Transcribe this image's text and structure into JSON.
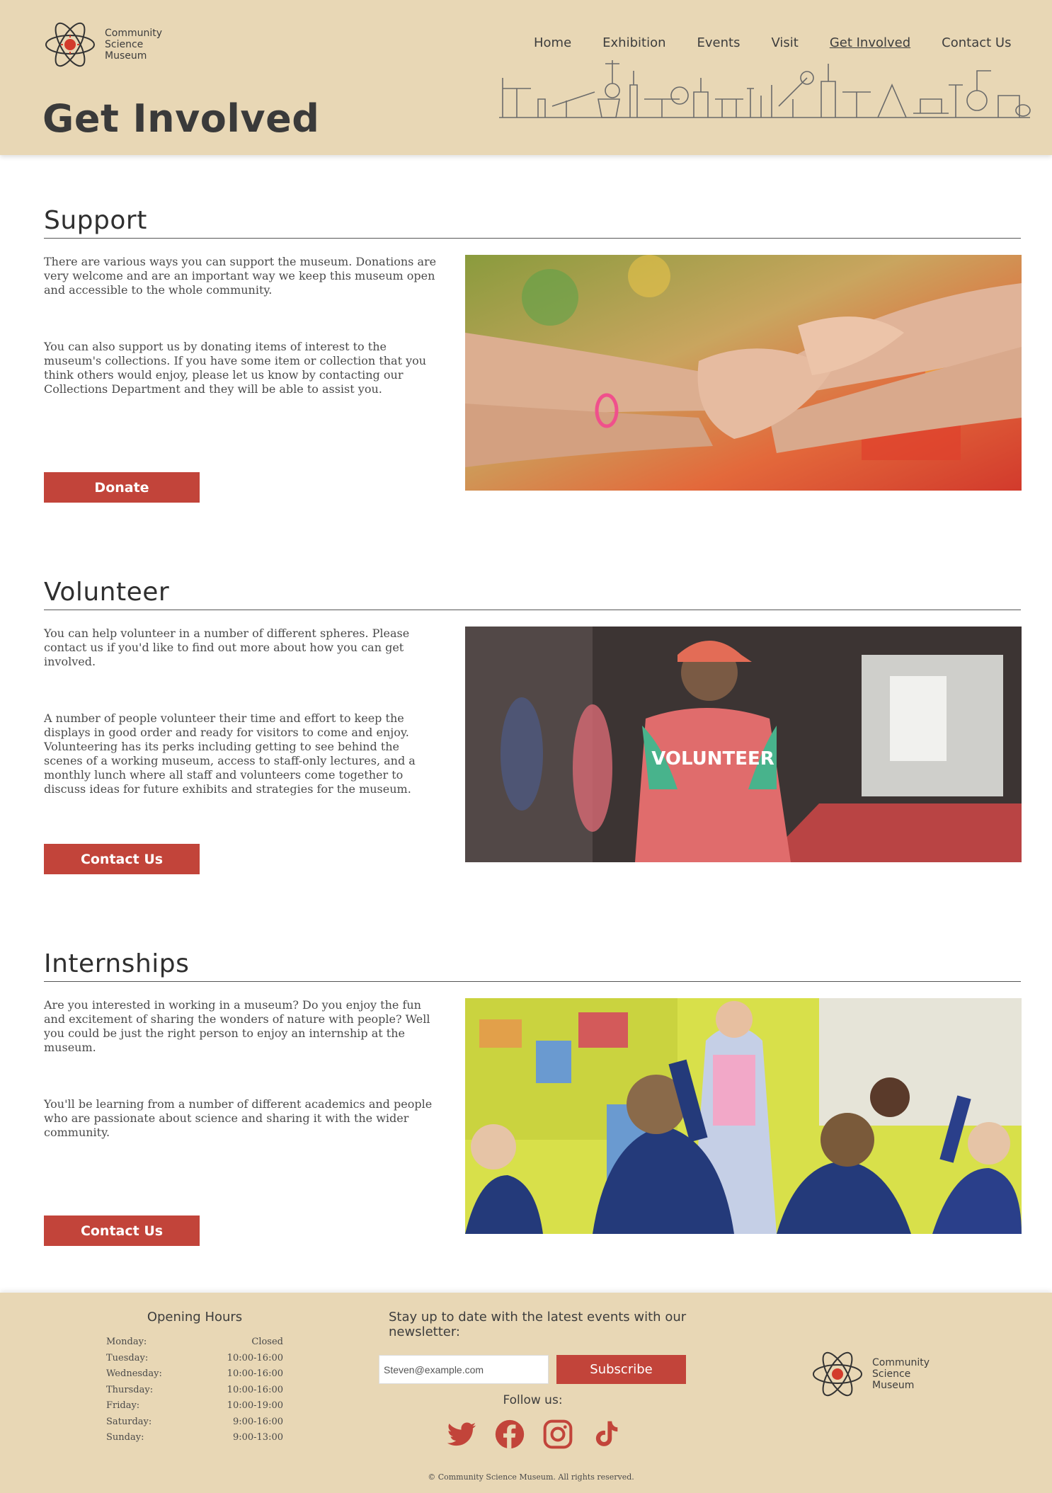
{
  "brand": {
    "line1": "Community",
    "line2": "Science",
    "line3": "Museum"
  },
  "nav": {
    "items": [
      {
        "label": "Home"
      },
      {
        "label": "Exhibition"
      },
      {
        "label": "Events"
      },
      {
        "label": "Visit"
      },
      {
        "label": "Get Involved"
      },
      {
        "label": "Contact Us"
      }
    ],
    "active": "Get Involved"
  },
  "page_title": "Get Involved",
  "sections": [
    {
      "heading": "Support",
      "paragraphs": [
        "There are various ways you can support the museum. Donations are very welcome and are an important way we keep this museum open and accessible to the whole community.",
        "You can also support us by donating items of interest to the museum's collections. If you have some item or collection that you think others would enjoy, please let us know by contacting our Collections Department and they will be able to assist you."
      ],
      "button": "Donate"
    },
    {
      "heading": "Volunteer",
      "paragraphs": [
        "You can help volunteer in a number of different spheres. Please contact us if you'd like to find out more about how you can get involved.",
        "A number of people volunteer their time and effort to keep the displays in good order and ready for visitors to come and enjoy. Volunteering has its perks including getting to see behind the scenes of a working museum, access to staff-only lectures, and a monthly lunch where all staff and volunteers come together to discuss ideas for future exhibits and strategies for the museum."
      ],
      "button": "Contact Us",
      "photo_text": "VOLUNTEER"
    },
    {
      "heading": "Internships",
      "paragraphs": [
        "Are you interested in working in a museum? Do you enjoy the fun and excitement of sharing the wonders of nature with people? Well you could be just the right person to enjoy an internship at the museum.",
        "You'll be learning from a number of different academics and people who are passionate about science and sharing it with the wider community."
      ],
      "button": "Contact Us"
    }
  ],
  "footer": {
    "hours_title": "Opening Hours",
    "hours": [
      {
        "day": "Monday:",
        "time": "Closed"
      },
      {
        "day": "Tuesday:",
        "time": "10:00-16:00"
      },
      {
        "day": "Wednesday:",
        "time": "10:00-16:00"
      },
      {
        "day": "Thursday:",
        "time": "10:00-16:00"
      },
      {
        "day": "Friday:",
        "time": "10:00-19:00"
      },
      {
        "day": "Saturday:",
        "time": "9:00-16:00"
      },
      {
        "day": "Sunday:",
        "time": "9:00-13:00"
      }
    ],
    "newsletter_text": "Stay up to date with the latest events with our newsletter:",
    "email_value": "Steven@example.com",
    "subscribe_label": "Subscribe",
    "follow_label": "Follow us:",
    "socials": [
      "twitter-icon",
      "facebook-icon",
      "instagram-icon",
      "tiktok-icon"
    ],
    "copyright": "© Community Science Museum. All rights reserved."
  },
  "colors": {
    "header_bg": "#e8d7b5",
    "accent": "#c2443a",
    "text": "#3a3a3a"
  }
}
